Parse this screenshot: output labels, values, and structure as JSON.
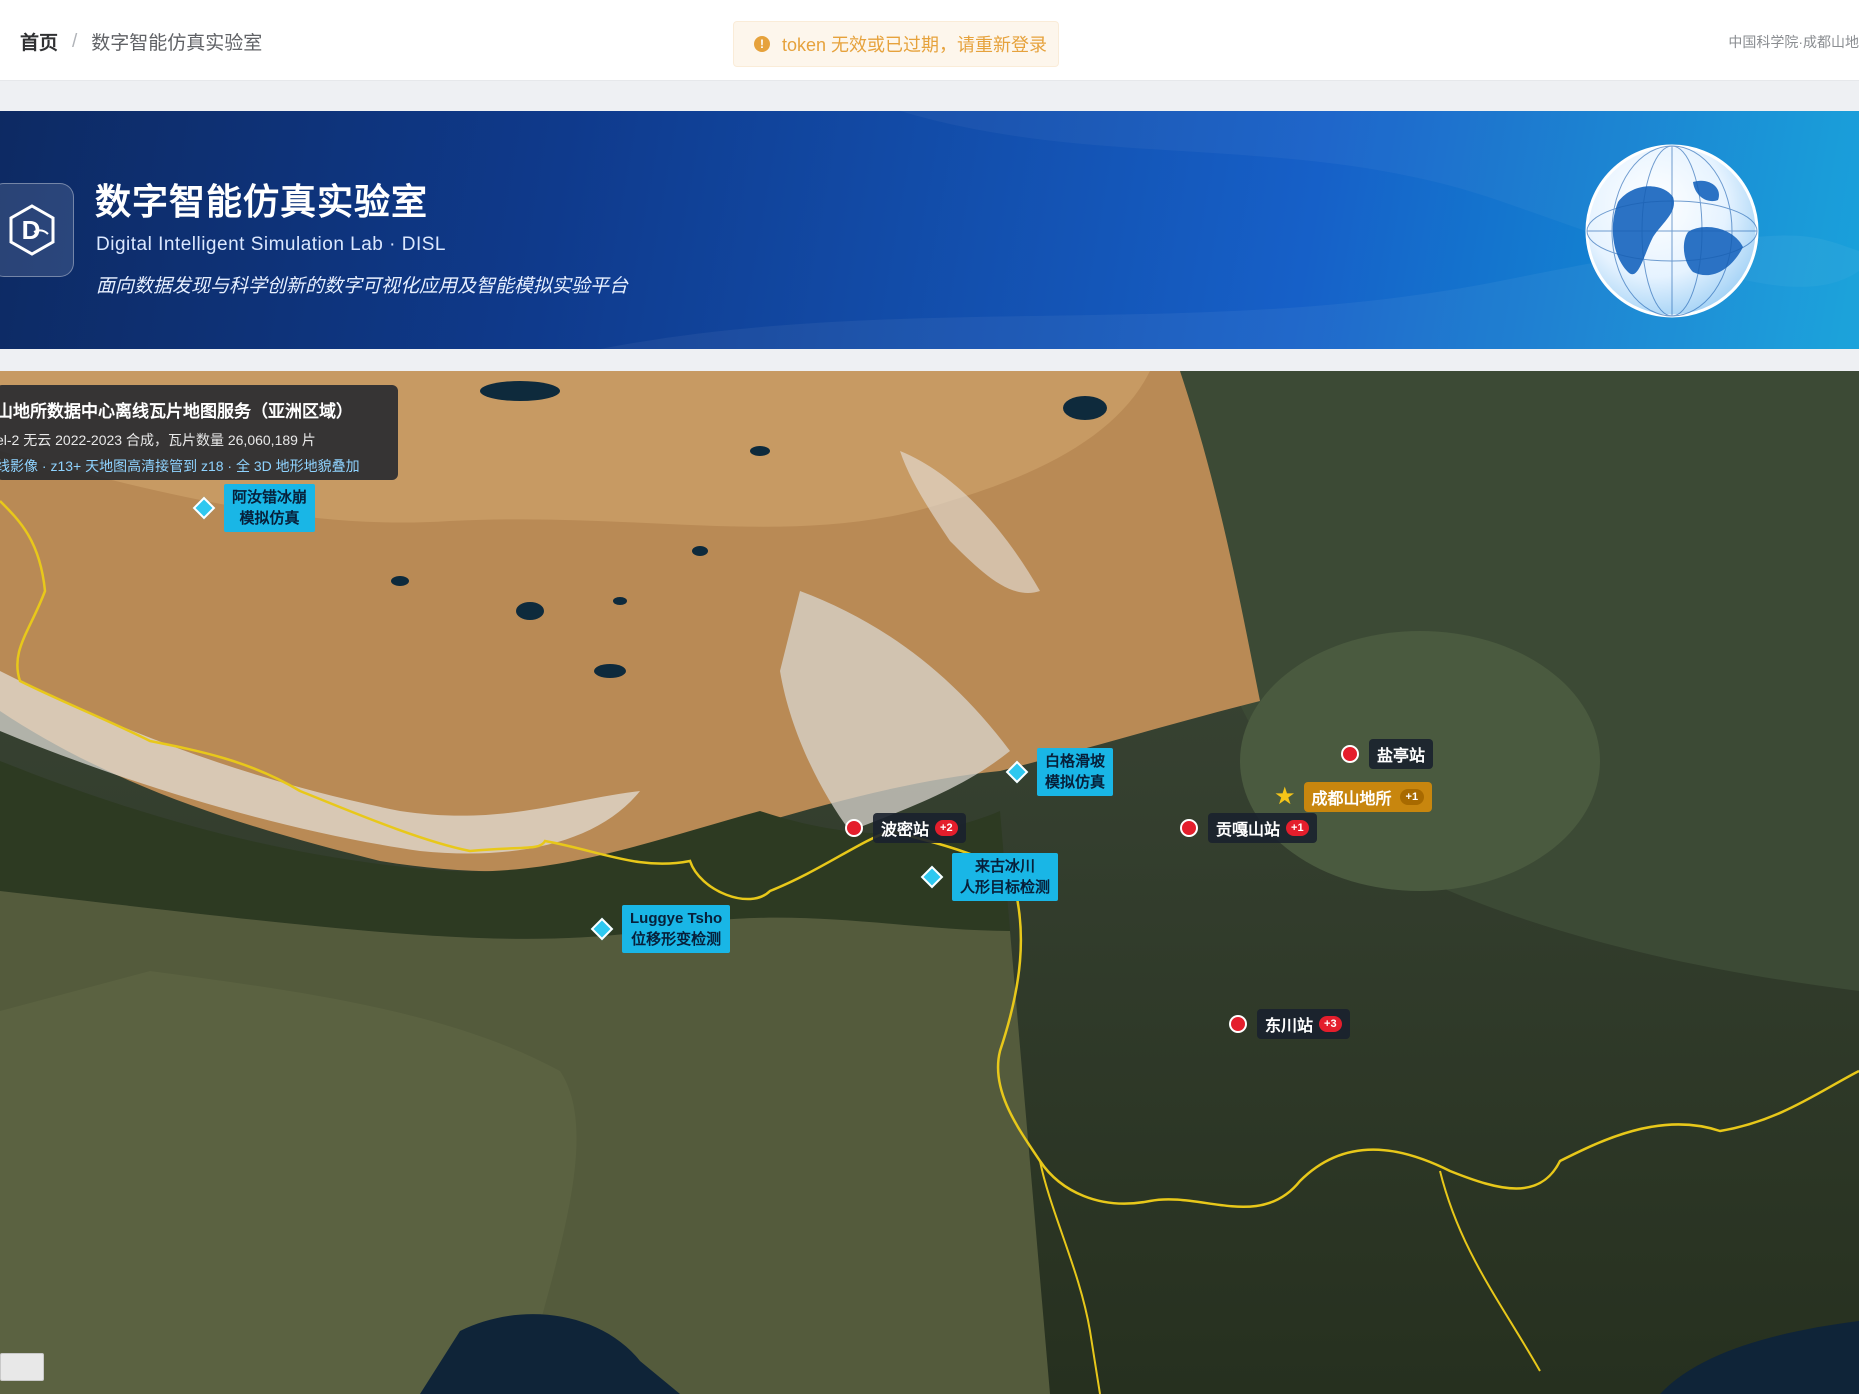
{
  "breadcrumb": {
    "home": "首页",
    "separator": "/",
    "current": "数字智能仿真实验室"
  },
  "toast": {
    "icon": "warning-icon",
    "message": "token 无效或已过期，请重新登录"
  },
  "top_right": {
    "org_text": "中国科学院·成都山地"
  },
  "banner": {
    "logo_letter": "D",
    "title": "数字智能仿真实验室",
    "subtitle": "Digital Intelligent Simulation Lab · DISL",
    "description": "面向数据发现与科学创新的数字可视化应用及智能模拟实验平台"
  },
  "map": {
    "info": {
      "title": "山地所数据中心离线瓦片地图服务（亚洲区域）",
      "line1": "el-2 无云 2022-2023 合成，瓦片数量 26,060,189 片",
      "line2": "线影像 · z13+ 天地图高清接管到 z18 · 全 3D 地形地貌叠加"
    },
    "simulations": [
      {
        "line1": "阿汝错冰崩",
        "line2": "模拟仿真"
      },
      {
        "line1": "白格滑坡",
        "line2": "模拟仿真"
      },
      {
        "line1": "来古冰川",
        "line2": "人形目标检测"
      },
      {
        "line1": "Luggye Tsho",
        "line2": "位移形变检测"
      }
    ],
    "stations": [
      {
        "name": "盐亭站",
        "count": ""
      },
      {
        "name": "波密站",
        "count": "+2"
      },
      {
        "name": "贡嘎山站",
        "count": "+1"
      },
      {
        "name": "东川站",
        "count": "+3"
      }
    ],
    "institute": {
      "name": "成都山地所",
      "count": "+1"
    }
  },
  "colors": {
    "accent": "#19b6e6",
    "station": "#e41e2c",
    "institute": "#c8860e",
    "warning": "#e6a23c",
    "border_line": "#e8c81a"
  }
}
